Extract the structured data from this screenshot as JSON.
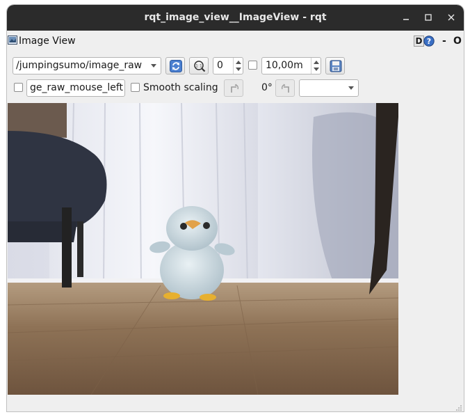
{
  "window": {
    "title": "rqt_image_view__ImageView - rqt"
  },
  "dock": {
    "title": "Image View",
    "d_button": "D",
    "help_icon": "help-icon",
    "minimize_label": "-",
    "close_label": "O"
  },
  "toolbar": {
    "topic": "/jumpingsumo/image_raw",
    "zoom_value": "0",
    "distance_value": "10,00m",
    "mouse_topic": "ge_raw_mouse_left",
    "smooth_label": "Smooth scaling",
    "rotation_label": "0°",
    "color_scheme_value": ""
  },
  "icons": {
    "refresh": "refresh-icon",
    "zoom": "zoom-fit-icon",
    "save": "save-image-icon",
    "rotate_left": "rotate-left-icon",
    "rotate_right": "rotate-right-icon"
  },
  "colors": {
    "titlebar": "#2b2b2b",
    "background": "#efefef",
    "accent": "#3a6fc4"
  }
}
